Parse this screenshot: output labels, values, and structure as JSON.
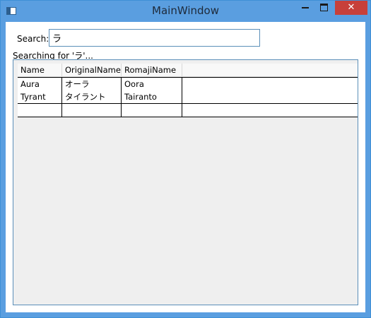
{
  "window": {
    "title": "MainWindow",
    "min_icon": "minimize-icon",
    "max_icon": "maximize-icon",
    "close_icon": "close-icon",
    "close_glyph": "✕",
    "close_color": "#c7403a",
    "titlebar_color": "#5a9ee0"
  },
  "search": {
    "label": "Search:",
    "value": "ラ"
  },
  "status": {
    "text": "Searching for 'ラ'..."
  },
  "grid": {
    "columns": [
      "Name",
      "OriginalName",
      "RomajiName"
    ],
    "rows": [
      [
        "Aura",
        "オーラ",
        "Oora"
      ],
      [
        "Tyrant",
        "タイラント",
        "Tairanto"
      ],
      [
        "",
        "",
        ""
      ]
    ]
  }
}
